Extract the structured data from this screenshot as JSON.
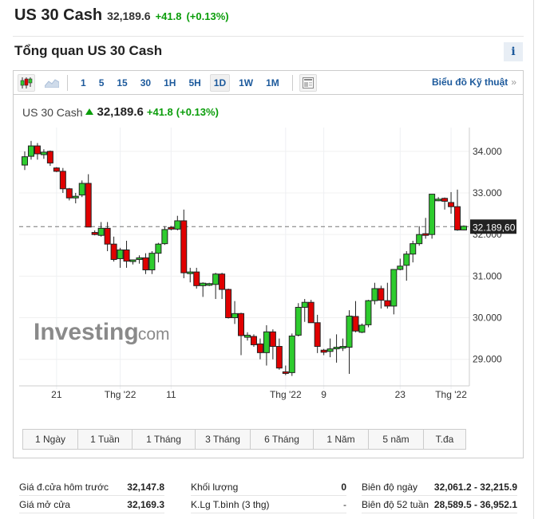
{
  "header": {
    "title": "US 30 Cash",
    "price": "32,189.6",
    "change": "+41.8",
    "change_pct": "(+0.13%)"
  },
  "overview": {
    "title": "Tổng quan US 30 Cash",
    "info_label": "i"
  },
  "toolbar": {
    "periods": [
      "1",
      "5",
      "15",
      "30",
      "1H",
      "5H",
      "1D",
      "1W",
      "1M"
    ],
    "active_period": "1D",
    "tech_link": "Biểu đồ Kỹ thuật",
    "tech_arrow": "»"
  },
  "chart_header": {
    "name": "US 30 Cash",
    "price": "32,189.6",
    "change": "+41.8",
    "change_pct": "(+0.13%)"
  },
  "ranges": [
    "1 Ngày",
    "1 Tuần",
    "1 Tháng",
    "3 Tháng",
    "6 Tháng",
    "1 Năm",
    "5 năm",
    "T.đa"
  ],
  "stats": {
    "prev_close_label": "Giá đ.cửa hôm trước",
    "prev_close": "32,147.8",
    "open_label": "Giá mở cửa",
    "open": "32,169.3",
    "volume_label": "Khối lượng",
    "volume": "0",
    "avg_vol_label": "K.Lg T.bình (3 thg)",
    "avg_vol": "-",
    "day_range_label": "Biên độ ngày",
    "day_range": "32,061.2 - 32,215.9",
    "week52_label": "Biên độ 52 tuần",
    "week52": "28,589.5 - 36,952.1"
  },
  "colors": {
    "up": "#2ecc2e",
    "down": "#e00000",
    "accent": "#1d5a9c",
    "positive": "#0a9d0a"
  },
  "chart_data": {
    "type": "candlestick",
    "watermark": "Investing.com",
    "ylim": [
      28.4,
      34.38
    ],
    "yticks": [
      "34.000",
      "33.000",
      "32.000",
      "31.000",
      "30.000",
      "29.000"
    ],
    "ytick_values": [
      34,
      33,
      32,
      31,
      30,
      29
    ],
    "last_price_label": "32.189,60",
    "last_price": 32.1896,
    "xticks": [
      {
        "label": "21",
        "index": 5
      },
      {
        "label": "Thg '22",
        "index": 15
      },
      {
        "label": "11",
        "index": 23
      },
      {
        "label": "Thg '22",
        "index": 41
      },
      {
        "label": "9",
        "index": 47
      },
      {
        "label": "23",
        "index": 59
      },
      {
        "label": "Thg '22",
        "index": 67
      }
    ],
    "ohlc": [
      [
        33.67,
        34.0,
        33.55,
        33.87
      ],
      [
        33.88,
        34.25,
        33.8,
        34.13
      ],
      [
        34.13,
        34.2,
        33.8,
        33.94
      ],
      [
        33.92,
        34.05,
        33.82,
        33.98
      ],
      [
        34.0,
        34.02,
        33.65,
        33.72
      ],
      [
        33.6,
        33.62,
        33.5,
        33.52
      ],
      [
        33.52,
        33.6,
        33.0,
        33.1
      ],
      [
        33.1,
        33.12,
        32.82,
        32.88
      ],
      [
        32.88,
        33.0,
        32.75,
        32.92
      ],
      [
        32.95,
        33.3,
        32.9,
        33.23
      ],
      [
        33.23,
        33.45,
        32.18,
        32.18
      ],
      [
        32.05,
        32.1,
        31.98,
        32.0
      ],
      [
        31.98,
        32.3,
        31.95,
        32.15
      ],
      [
        32.15,
        32.3,
        31.6,
        31.77
      ],
      [
        31.77,
        31.95,
        31.35,
        31.4
      ],
      [
        31.42,
        31.68,
        31.2,
        31.63
      ],
      [
        31.63,
        31.85,
        31.2,
        31.36
      ],
      [
        31.35,
        31.4,
        31.28,
        31.39
      ],
      [
        31.4,
        31.5,
        31.3,
        31.44
      ],
      [
        31.44,
        31.55,
        31.05,
        31.15
      ],
      [
        31.15,
        31.6,
        31.05,
        31.55
      ],
      [
        31.55,
        31.8,
        31.33,
        31.77
      ],
      [
        31.78,
        32.2,
        31.75,
        32.12
      ],
      [
        32.17,
        32.2,
        32.1,
        32.13
      ],
      [
        32.13,
        32.45,
        32.1,
        32.33
      ],
      [
        32.33,
        32.6,
        30.95,
        31.08
      ],
      [
        31.06,
        31.2,
        30.85,
        31.1
      ],
      [
        31.1,
        31.2,
        30.7,
        30.77
      ],
      [
        30.77,
        30.85,
        30.5,
        30.83
      ],
      [
        30.78,
        30.84,
        30.76,
        30.82
      ],
      [
        30.8,
        31.08,
        30.45,
        31.05
      ],
      [
        31.05,
        31.08,
        30.45,
        30.68
      ],
      [
        30.68,
        30.7,
        29.98,
        30.0
      ],
      [
        30.0,
        30.4,
        29.85,
        30.1
      ],
      [
        30.1,
        30.12,
        29.1,
        29.57
      ],
      [
        29.53,
        29.65,
        29.45,
        29.58
      ],
      [
        29.55,
        29.6,
        29.3,
        29.35
      ],
      [
        29.37,
        29.5,
        29.0,
        29.16
      ],
      [
        29.16,
        29.82,
        28.85,
        29.66
      ],
      [
        29.66,
        29.72,
        29.0,
        29.31
      ],
      [
        29.31,
        29.5,
        28.75,
        28.79
      ],
      [
        28.7,
        28.85,
        28.62,
        28.66
      ],
      [
        28.68,
        29.62,
        28.6,
        29.56
      ],
      [
        29.58,
        30.35,
        29.55,
        30.25
      ],
      [
        30.25,
        30.45,
        29.9,
        30.37
      ],
      [
        30.37,
        30.43,
        29.88,
        29.88
      ],
      [
        29.88,
        30.07,
        29.15,
        29.31
      ],
      [
        29.22,
        29.25,
        29.1,
        29.17
      ],
      [
        29.19,
        29.5,
        29.05,
        29.25
      ],
      [
        29.26,
        29.6,
        28.92,
        29.29
      ],
      [
        29.27,
        29.5,
        29.2,
        29.31
      ],
      [
        29.29,
        30.18,
        28.65,
        30.04
      ],
      [
        30.03,
        30.4,
        29.65,
        29.68
      ],
      [
        29.65,
        29.86,
        29.63,
        29.82
      ],
      [
        29.83,
        30.43,
        29.77,
        30.41
      ],
      [
        30.41,
        30.84,
        30.32,
        30.7
      ],
      [
        30.7,
        30.77,
        30.22,
        30.42
      ],
      [
        30.41,
        30.84,
        30.22,
        30.28
      ],
      [
        30.28,
        31.16,
        30.08,
        31.16
      ],
      [
        31.16,
        31.42,
        31.14,
        31.24
      ],
      [
        31.26,
        31.6,
        30.89,
        31.53
      ],
      [
        31.53,
        31.85,
        31.33,
        31.78
      ],
      [
        31.78,
        32.2,
        31.73,
        32.0
      ],
      [
        32.02,
        32.4,
        31.9,
        31.98
      ],
      [
        32.0,
        32.97,
        31.9,
        32.97
      ],
      [
        32.82,
        32.9,
        32.8,
        32.85
      ],
      [
        32.87,
        32.89,
        32.6,
        32.8
      ],
      [
        32.77,
        33.02,
        32.5,
        32.67
      ],
      [
        32.67,
        33.08,
        32.09,
        32.11
      ],
      [
        32.11,
        32.22,
        32.1,
        32.2
      ]
    ]
  }
}
